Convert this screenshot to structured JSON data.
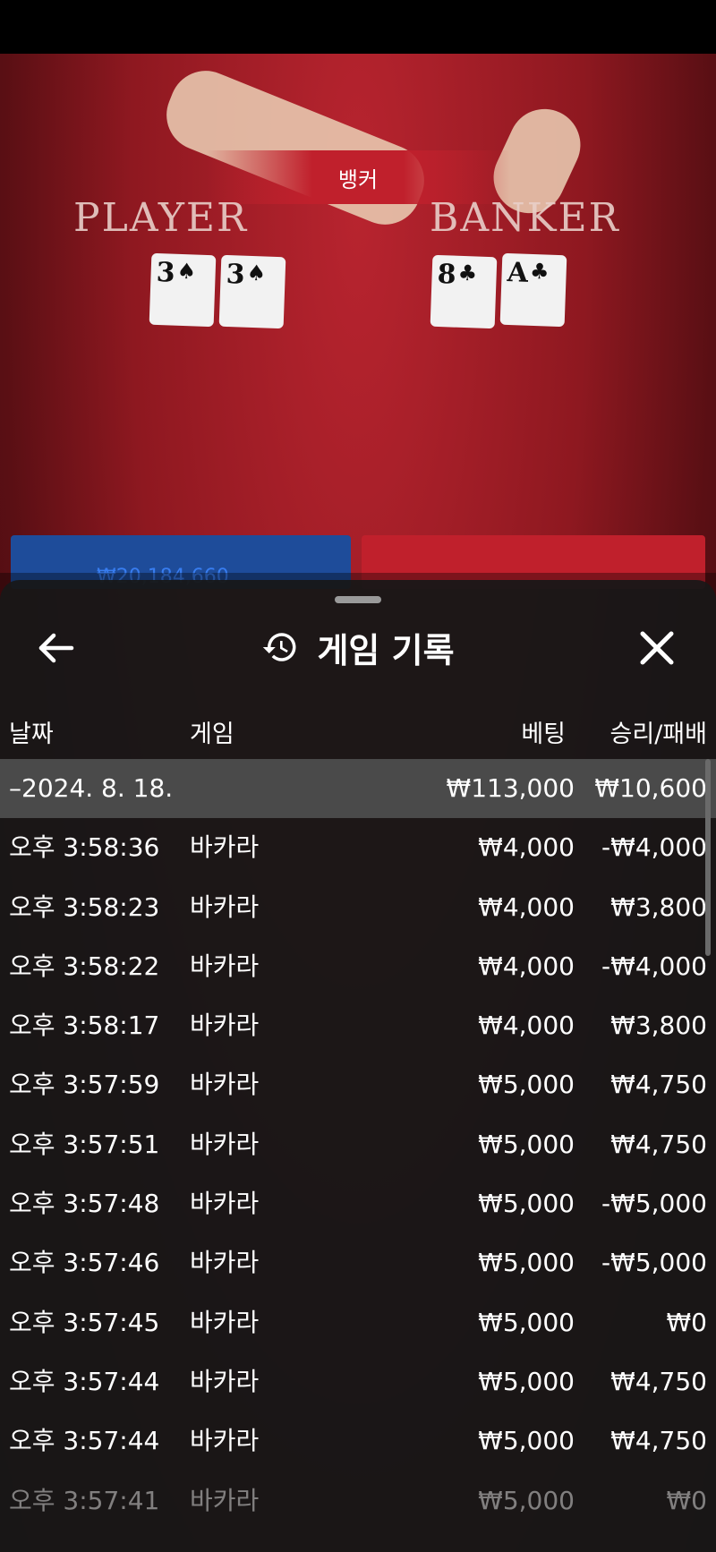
{
  "table": {
    "banner_text": "뱅커",
    "player_label": "PLAYER",
    "banker_label": "BANKER",
    "player_cards": [
      {
        "rank": "3",
        "suit": "♠"
      },
      {
        "rank": "3",
        "suit": "♠"
      }
    ],
    "banker_cards": [
      {
        "rank": "8",
        "suit": "♣"
      },
      {
        "rank": "A",
        "suit": "♣"
      }
    ],
    "player_total": "₩20,184,660",
    "colors": {
      "player": "#1e4c9a",
      "banker": "#c0202c"
    }
  },
  "panel": {
    "title": "게임 기록",
    "title_icon": "history-icon",
    "back_icon": "arrow-left-icon",
    "close_icon": "close-icon",
    "columns": {
      "date": "날짜",
      "game": "게임",
      "bet": "베팅",
      "win": "승리/패배"
    },
    "total_row": {
      "date": "–2024. 8. 18.",
      "bet": "₩113,000",
      "win": "₩10,600"
    },
    "rows": [
      {
        "time": "오후 3:58:36",
        "game": "바카라",
        "bet": "₩4,000",
        "win": "-₩4,000"
      },
      {
        "time": "오후 3:58:23",
        "game": "바카라",
        "bet": "₩4,000",
        "win": "₩3,800"
      },
      {
        "time": "오후 3:58:22",
        "game": "바카라",
        "bet": "₩4,000",
        "win": "-₩4,000"
      },
      {
        "time": "오후 3:58:17",
        "game": "바카라",
        "bet": "₩4,000",
        "win": "₩3,800"
      },
      {
        "time": "오후 3:57:59",
        "game": "바카라",
        "bet": "₩5,000",
        "win": "₩4,750"
      },
      {
        "time": "오후 3:57:51",
        "game": "바카라",
        "bet": "₩5,000",
        "win": "₩4,750"
      },
      {
        "time": "오후 3:57:48",
        "game": "바카라",
        "bet": "₩5,000",
        "win": "-₩5,000"
      },
      {
        "time": "오후 3:57:46",
        "game": "바카라",
        "bet": "₩5,000",
        "win": "-₩5,000"
      },
      {
        "time": "오후 3:57:45",
        "game": "바카라",
        "bet": "₩5,000",
        "win": "₩0"
      },
      {
        "time": "오후 3:57:44",
        "game": "바카라",
        "bet": "₩5,000",
        "win": "₩4,750"
      },
      {
        "time": "오후 3:57:44",
        "game": "바카라",
        "bet": "₩5,000",
        "win": "₩4,750"
      },
      {
        "time": "오후 3:57:41",
        "game": "바카라",
        "bet": "₩5,000",
        "win": "₩0"
      }
    ]
  }
}
